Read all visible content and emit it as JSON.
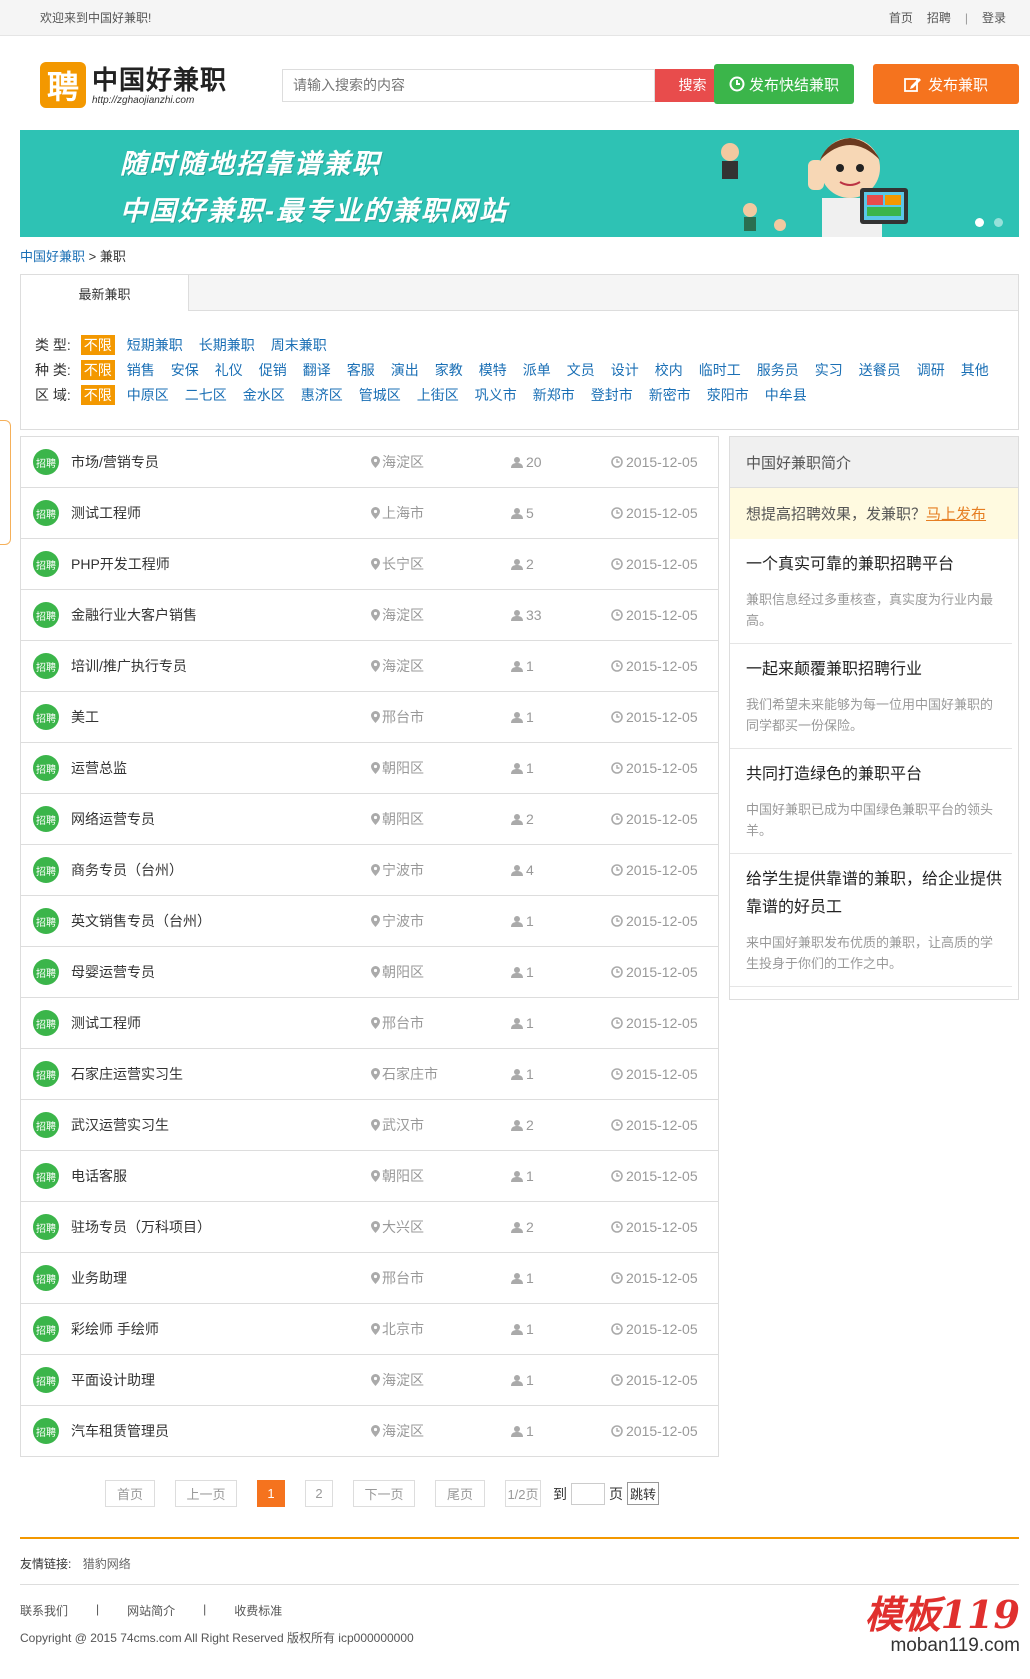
{
  "topbar": {
    "welcome": "欢迎来到中国好兼职!",
    "links": [
      "首页",
      "招聘",
      "登录"
    ],
    "sep": "|"
  },
  "header": {
    "logo_char": "聘",
    "logo_name": "中国好兼职",
    "logo_url": "http://zghaojianzhi.com",
    "search_placeholder": "请输入搜索的内容",
    "search_button": "搜索",
    "quick_button": "发布快结兼职",
    "post_button": "发布兼职"
  },
  "banner": {
    "line1": "随时随地招靠谱兼职",
    "line2": "中国好兼职-最专业的兼职网站"
  },
  "breadcrumb": {
    "home": "中国好兼职",
    "sep": ">",
    "current": "兼职"
  },
  "filter": {
    "tab": "最新兼职",
    "rows": [
      {
        "label": "类 型:",
        "options": [
          "不限",
          "短期兼职",
          "长期兼职",
          "周末兼职"
        ]
      },
      {
        "label": "种 类:",
        "options": [
          "不限",
          "销售",
          "安保",
          "礼仪",
          "促销",
          "翻译",
          "客服",
          "演出",
          "家教",
          "模特",
          "派单",
          "文员",
          "设计",
          "校内",
          "临时工",
          "服务员",
          "实习",
          "送餐员",
          "调研",
          "其他"
        ]
      },
      {
        "label": "区 域:",
        "options": [
          "不限",
          "中原区",
          "二七区",
          "金水区",
          "惠济区",
          "管城区",
          "上街区",
          "巩义市",
          "新郑市",
          "登封市",
          "新密市",
          "荥阳市",
          "中牟县"
        ]
      }
    ]
  },
  "jobs": {
    "tag": "招聘",
    "items": [
      {
        "title": "市场/营销专员",
        "location": "海淀区",
        "count": "20",
        "date": "2015-12-05"
      },
      {
        "title": "测试工程师",
        "location": "上海市",
        "count": "5",
        "date": "2015-12-05"
      },
      {
        "title": "PHP开发工程师",
        "location": "长宁区",
        "count": "2",
        "date": "2015-12-05"
      },
      {
        "title": "金融行业大客户销售",
        "location": "海淀区",
        "count": "33",
        "date": "2015-12-05"
      },
      {
        "title": "培训/推广执行专员",
        "location": "海淀区",
        "count": "1",
        "date": "2015-12-05"
      },
      {
        "title": "美工",
        "location": "邢台市",
        "count": "1",
        "date": "2015-12-05"
      },
      {
        "title": "运营总监",
        "location": "朝阳区",
        "count": "1",
        "date": "2015-12-05"
      },
      {
        "title": "网络运营专员",
        "location": "朝阳区",
        "count": "2",
        "date": "2015-12-05"
      },
      {
        "title": "商务专员（台州）",
        "location": "宁波市",
        "count": "4",
        "date": "2015-12-05"
      },
      {
        "title": "英文销售专员（台州）",
        "location": "宁波市",
        "count": "1",
        "date": "2015-12-05"
      },
      {
        "title": "母婴运营专员",
        "location": "朝阳区",
        "count": "1",
        "date": "2015-12-05"
      },
      {
        "title": "测试工程师",
        "location": "邢台市",
        "count": "1",
        "date": "2015-12-05"
      },
      {
        "title": "石家庄运营实习生",
        "location": "石家庄市",
        "count": "1",
        "date": "2015-12-05"
      },
      {
        "title": "武汉运营实习生",
        "location": "武汉市",
        "count": "2",
        "date": "2015-12-05"
      },
      {
        "title": "电话客服",
        "location": "朝阳区",
        "count": "1",
        "date": "2015-12-05"
      },
      {
        "title": "驻场专员（万科项目）",
        "location": "大兴区",
        "count": "2",
        "date": "2015-12-05"
      },
      {
        "title": "业务助理",
        "location": "邢台市",
        "count": "1",
        "date": "2015-12-05"
      },
      {
        "title": "彩绘师 手绘师",
        "location": "北京市",
        "count": "1",
        "date": "2015-12-05"
      },
      {
        "title": "平面设计助理",
        "location": "海淀区",
        "count": "1",
        "date": "2015-12-05"
      },
      {
        "title": "汽车租赁管理员",
        "location": "海淀区",
        "count": "1",
        "date": "2015-12-05"
      }
    ]
  },
  "sidebar": {
    "title": "中国好兼职简介",
    "hint": "想提高招聘效果，发兼职？",
    "hint_link": "马上发布",
    "items": [
      {
        "title": "一个真实可靠的兼职招聘平台",
        "desc": "兼职信息经过多重核查，真实度为行业内最高。"
      },
      {
        "title": "一起来颠覆兼职招聘行业",
        "desc": "我们希望未来能够为每一位用中国好兼职的同学都买一份保险。"
      },
      {
        "title": "共同打造绿色的兼职平台",
        "desc": "中国好兼职已成为中国绿色兼职平台的领头羊。"
      },
      {
        "title": "给学生提供靠谱的兼职，给企业提供靠谱的好员工",
        "desc": "来中国好兼职发布优质的兼职，让高质的学生投身于你们的工作之中。"
      }
    ]
  },
  "pager": {
    "first": "首页",
    "prev": "上一页",
    "current": "1",
    "page2": "2",
    "next": "下一页",
    "last": "尾页",
    "info": "1/2页",
    "goto": "到",
    "page_unit": "页",
    "jump": "跳转"
  },
  "footer": {
    "friend_label": "友情链接:",
    "friend_link": "猎豹网络",
    "nav": [
      "联系我们",
      "|",
      "网站简介",
      "|",
      "收费标准"
    ],
    "copyright": "Copyright @ 2015 74cms.com All Right Reserved 版权所有 icp000000000"
  },
  "watermark": {
    "big": "模板119",
    "small": "moban119.com"
  },
  "colors": {
    "accent_orange": "#f39800",
    "green": "#3bb54a",
    "teal_banner": "#2ec2b4",
    "link_blue": "#1a6fb5",
    "search_red": "#e84c4c"
  }
}
